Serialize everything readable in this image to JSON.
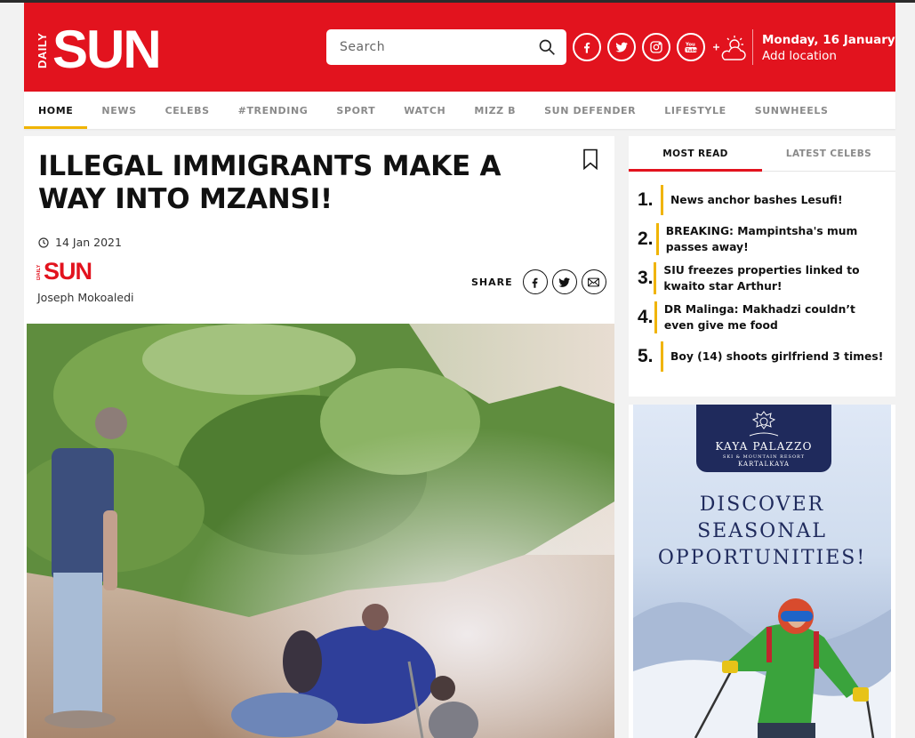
{
  "brand": {
    "logo_small": "DAILY",
    "logo_big": "SUN",
    "red": "#e2131e",
    "yellow": "#f0b400"
  },
  "header": {
    "search_placeholder": "Search",
    "date": "Monday, 16 January",
    "location": "Add location",
    "social": [
      "facebook-icon",
      "twitter-icon",
      "instagram-icon",
      "youtube-icon"
    ]
  },
  "nav": [
    {
      "label": "HOME",
      "active": true
    },
    {
      "label": "NEWS"
    },
    {
      "label": "CELEBS"
    },
    {
      "label": "#TRENDING"
    },
    {
      "label": "SPORT"
    },
    {
      "label": "WATCH"
    },
    {
      "label": "MIZZ B"
    },
    {
      "label": "SUN DEFENDER"
    },
    {
      "label": "LIFESTYLE"
    },
    {
      "label": "SUNWHEELS"
    }
  ],
  "article": {
    "title": "ILLEGAL IMMIGRANTS MAKE A WAY INTO MZANSI!",
    "date": "14 Jan 2021",
    "author": "Joseph Mokoaledi",
    "share_label": "SHARE"
  },
  "sidebar": {
    "tabs": [
      "MOST READ",
      "LATEST CELEBS"
    ],
    "most_read": [
      {
        "num": "1.",
        "title": "News anchor bashes Lesufi!"
      },
      {
        "num": "2.",
        "title": "BREAKING: Mampintsha's mum passes away!"
      },
      {
        "num": "3.",
        "title": "SIU freezes properties linked to kwaito star Arthur!"
      },
      {
        "num": "4.",
        "title": "DR Malinga: Makhadzi couldn’t even give me food"
      },
      {
        "num": "5.",
        "title": "Boy (14) shoots girlfriend 3 times!"
      }
    ]
  },
  "ad": {
    "brand": "KAYA PALAZZO",
    "sub": "SKI & MOUNTAIN RESORT",
    "place": "KARTALKAYA",
    "lines": [
      "DISCOVER",
      "SEASONAL",
      "OPPORTUNITIES!"
    ]
  }
}
